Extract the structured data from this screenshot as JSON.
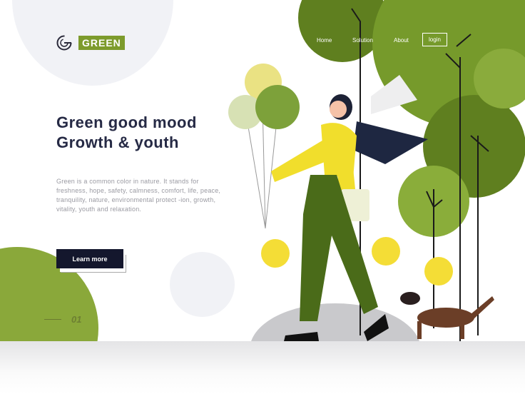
{
  "brand": {
    "name": "GREEN",
    "logo_letter": "G",
    "accent": "#7d9b2c"
  },
  "nav": {
    "items": [
      "Home",
      "Solution",
      "About"
    ],
    "login": "login"
  },
  "hero": {
    "title_line1": "Green good mood",
    "title_line2": "Growth & youth",
    "description": "Green is a common color in nature. It stands for freshness, hope, safety, calmness, comfort, life, peace, tranquility, nature, environmental protect -ion, growth, vitality, youth and relaxation.",
    "cta": "Learn more"
  },
  "pager": {
    "current": "01"
  }
}
